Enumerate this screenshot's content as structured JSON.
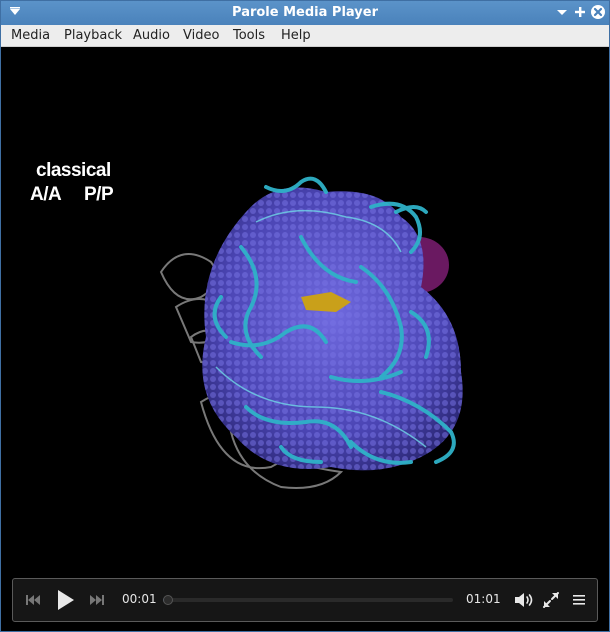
{
  "window": {
    "title": "Parole Media Player"
  },
  "menu": {
    "items": [
      "Media",
      "Playback",
      "Audio",
      "Video",
      "Tools",
      "Help"
    ]
  },
  "video_overlay": {
    "line1": "classical",
    "label_a": "A/A",
    "label_b": "P/P"
  },
  "controls": {
    "elapsed": "00:01",
    "duration": "01:01",
    "progress_fraction": 0.016,
    "icons": [
      "previous-icon",
      "play-icon",
      "next-icon",
      "volume-icon",
      "fullscreen-icon",
      "playlist-icon"
    ]
  },
  "colors": {
    "titlebar": "#4f88c1",
    "accent": "#3a6fc0",
    "ribosome_blue": "#5b55c9",
    "ribosome_cyan": "#2fb2c8",
    "ribosome_grey": "#8a8a8a",
    "ribosome_magenta": "#8a1f7a"
  }
}
